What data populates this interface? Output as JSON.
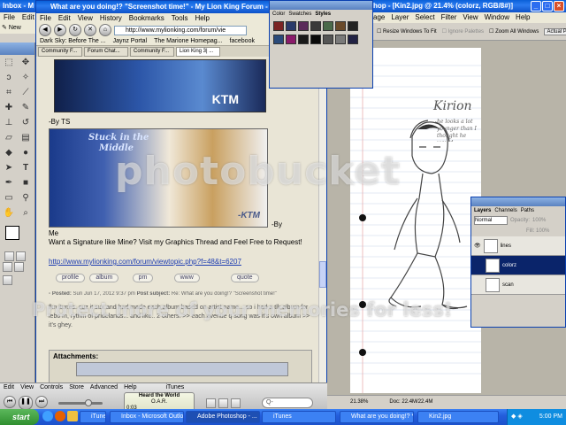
{
  "ps_app": {
    "title_short": "Inbox - M",
    "menu_left": [
      "File",
      "Edit"
    ],
    "new_label": "New"
  },
  "browser": {
    "title": "What are you doing!? \"Screenshot time!\" - My Lion King Forum - Mozilla Firef",
    "menu": [
      "File",
      "Edit",
      "View",
      "History",
      "Bookmarks",
      "Tools",
      "Help"
    ],
    "url": "http://www.mylionking.com/forum/vie",
    "bookmarks": [
      "Dark Sky: Before The ...",
      "Jaynz Portal",
      "The Marione Homepag...",
      "facebook"
    ],
    "tabs": [
      "Community F...",
      "Forum Chat...",
      "Community F...",
      "Lion King 3| ..."
    ],
    "banner_text": "KTM",
    "by_ts": "-By TS",
    "sig_title_1": "Stuck in the",
    "sig_title_2": "Middle",
    "sig_ktm": "-KTM",
    "by_me_1": "-By",
    "by_me_2": "Me",
    "sig_line": "Want a Signature like Mine? Visit my Graphics Thread and Feel Free to Request!",
    "sig_link": "http://www.mylionking.com/forum/viewtopic.php?f=48&t=6207",
    "post_buttons": [
      "profile",
      "album",
      "pm",
      "www",
      "quote"
    ],
    "posted_label": "Posted:",
    "posted_date": "Sun Jun 17, 2012 9:37 pm",
    "subject_label": "Post subject:",
    "subject_text": "Re: What are you doing!? \"Screenshot time!\"",
    "post_body": "fkn itunes. cuz it sux and had made each album based on artist name... so i had a tlk album for lebo m, rythm of pridelands... and like.. 2 others. >> each avenue q song was it's own album >> it's ghey.",
    "attachments_label": "Attachments:"
  },
  "swatches": {
    "tabs": [
      "Color",
      "Swatches",
      "Styles"
    ],
    "colors": [
      "#7a2424",
      "#2a3a6a",
      "#5a2a5a",
      "#3a3a3a",
      "#4a6a4a",
      "#6a4a2a",
      "#222222",
      "#2a4a7a",
      "#8a1a6a",
      "#1a1a1a",
      "#0a0a0a",
      "#555555",
      "#7a7a7a",
      "#222244"
    ]
  },
  "photoshop": {
    "title": "hop - [Kin2.jpg @ 21.4% (colorz, RGB/8#)]",
    "menu": [
      "age",
      "Layer",
      "Select",
      "Filter",
      "View",
      "Window",
      "Help"
    ],
    "options": [
      "Resize Windows To Fit",
      "Ignore Palettes",
      "Zoom All Windows",
      "Actual P"
    ],
    "sketch_name": "Kirion",
    "sketch_note": "he looks a lot younger than I thought he would",
    "zoom": "21.38%",
    "doc_info": "Doc: 22.4M/22.4M"
  },
  "layers": {
    "tabs": [
      "Layers",
      "Channels",
      "Paths"
    ],
    "blend": "Normal",
    "opacity_label": "Opacity:",
    "opacity": "100%",
    "fill_label": "Fill:",
    "fill": "100%",
    "items": [
      "lines",
      "colorz",
      "scan"
    ]
  },
  "itunes": {
    "menu": [
      "Edit",
      "View",
      "Controls",
      "Store",
      "Advanced",
      "Help"
    ],
    "title": "iTunes",
    "now_playing": "Heard the World",
    "artist": "O.A.R.",
    "elapsed": "0:03",
    "search_placeholder": "Q-"
  },
  "watermark": {
    "brand": "photobucket",
    "slogan": "Protect more of your memories for less!"
  },
  "taskbar": {
    "start": "start",
    "items": [
      "iTunes",
      "Inbox - Microsoft Outlook",
      "Adobe Photoshop - ...",
      "iTunes",
      "What are you doing!? *...",
      "Kin2.jpg"
    ],
    "clock": "5:00 PM"
  }
}
